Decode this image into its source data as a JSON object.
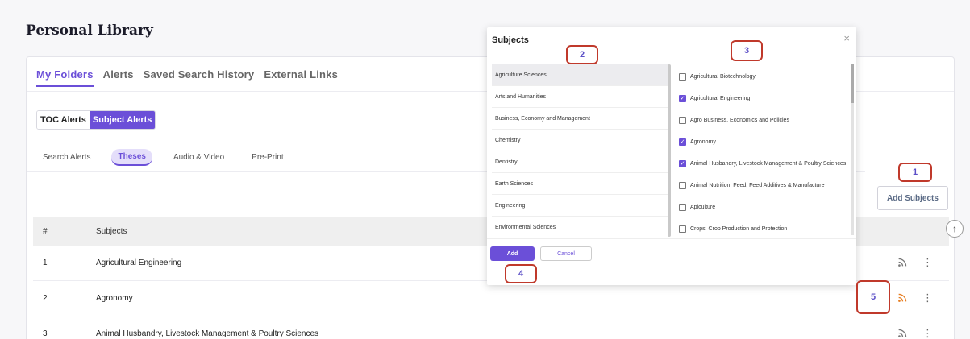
{
  "page": {
    "title": "Personal Library"
  },
  "main_tabs": [
    {
      "label": "My Folders",
      "active": true
    },
    {
      "label": "Alerts",
      "active": false
    },
    {
      "label": "Saved Search History",
      "active": false
    },
    {
      "label": "External Links",
      "active": false
    }
  ],
  "alert_toggle": {
    "toc": "TOC Alerts",
    "subject": "Subject Alerts"
  },
  "sub_tabs": [
    {
      "label": "Search Alerts",
      "active": false
    },
    {
      "label": "Theses",
      "active": true
    },
    {
      "label": "Audio & Video",
      "active": false
    },
    {
      "label": "Pre-Print",
      "active": false
    }
  ],
  "add_subjects_label": "Add Subjects",
  "table": {
    "headers": {
      "num": "#",
      "subjects": "Subjects"
    },
    "rows": [
      {
        "num": "1",
        "subject": "Agricultural Engineering"
      },
      {
        "num": "2",
        "subject": "Agronomy"
      },
      {
        "num": "3",
        "subject": "Animal Husbandry, Livestock Management & Poultry Sciences"
      }
    ]
  },
  "modal": {
    "title": "Subjects",
    "close": "×",
    "left_items": [
      "Agriculture Sciences",
      "Arts and Humanities",
      "Business, Economy and Management",
      "Chemistry",
      "Dentistry",
      "Earth Sciences",
      "Engineering",
      "Environmental Sciences"
    ],
    "right_items": [
      {
        "label": "Agricultural Biotechnology",
        "checked": false
      },
      {
        "label": "Agricultural Engineering",
        "checked": true
      },
      {
        "label": "Agro Business, Economics and Policies",
        "checked": false
      },
      {
        "label": "Agronomy",
        "checked": true
      },
      {
        "label": "Animal Husbandry, Livestock Management & Poultry Sciences",
        "checked": true
      },
      {
        "label": "Animal Nutrition, Feed, Feed Additives & Manufacture",
        "checked": false
      },
      {
        "label": "Apiculture",
        "checked": false
      },
      {
        "label": "Crops, Crop Production and Protection",
        "checked": false
      }
    ],
    "add": "Add",
    "cancel": "Cancel"
  },
  "callouts": [
    "1",
    "2",
    "3",
    "4",
    "5"
  ],
  "colors": {
    "accent": "#6b4fd8",
    "callout_border": "#c0392b",
    "rss_active": "#e67e22",
    "rss_inactive": "#777777"
  }
}
